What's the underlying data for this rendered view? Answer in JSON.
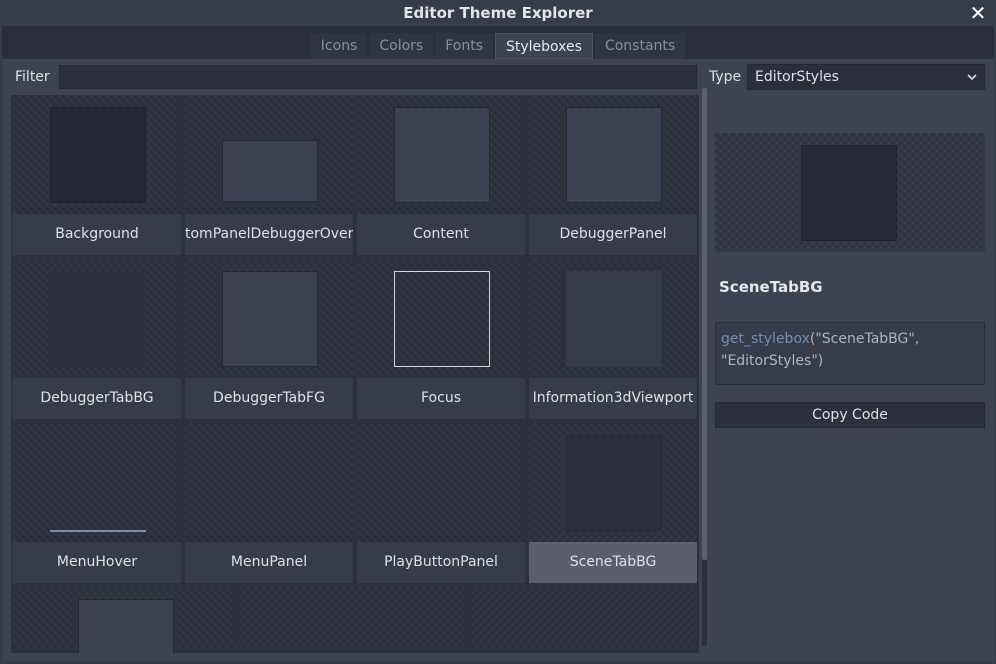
{
  "window": {
    "title": "Editor Theme Explorer"
  },
  "tabs": [
    "Icons",
    "Colors",
    "Fonts",
    "Styleboxes",
    "Constants"
  ],
  "active_tab": "Styleboxes",
  "filter": {
    "label": "Filter",
    "value": ""
  },
  "type": {
    "label": "Type",
    "selected": "EditorStyles"
  },
  "styleboxes": [
    "Background",
    "tomPanelDebuggerOverr",
    "Content",
    "DebuggerPanel",
    "DebuggerTabBG",
    "DebuggerTabFG",
    "Focus",
    "Information3dViewport",
    "MenuHover",
    "MenuPanel",
    "PlayButtonPanel",
    "SceneTabBG"
  ],
  "selected_stylebox": "SceneTabBG",
  "detail": {
    "name": "SceneTabBG",
    "code_fn": "get_stylebox",
    "code_args_1": "(\"SceneTabBG\",",
    "code_args_2": "\"EditorStyles\")",
    "copy_label": "Copy Code"
  },
  "icons": {
    "close": "close-icon",
    "dropdown": "chevron-down-icon"
  },
  "colors": {
    "accent": "#6f8fb8",
    "selected": "#5a5f6b",
    "background": "#2a2f3b"
  }
}
